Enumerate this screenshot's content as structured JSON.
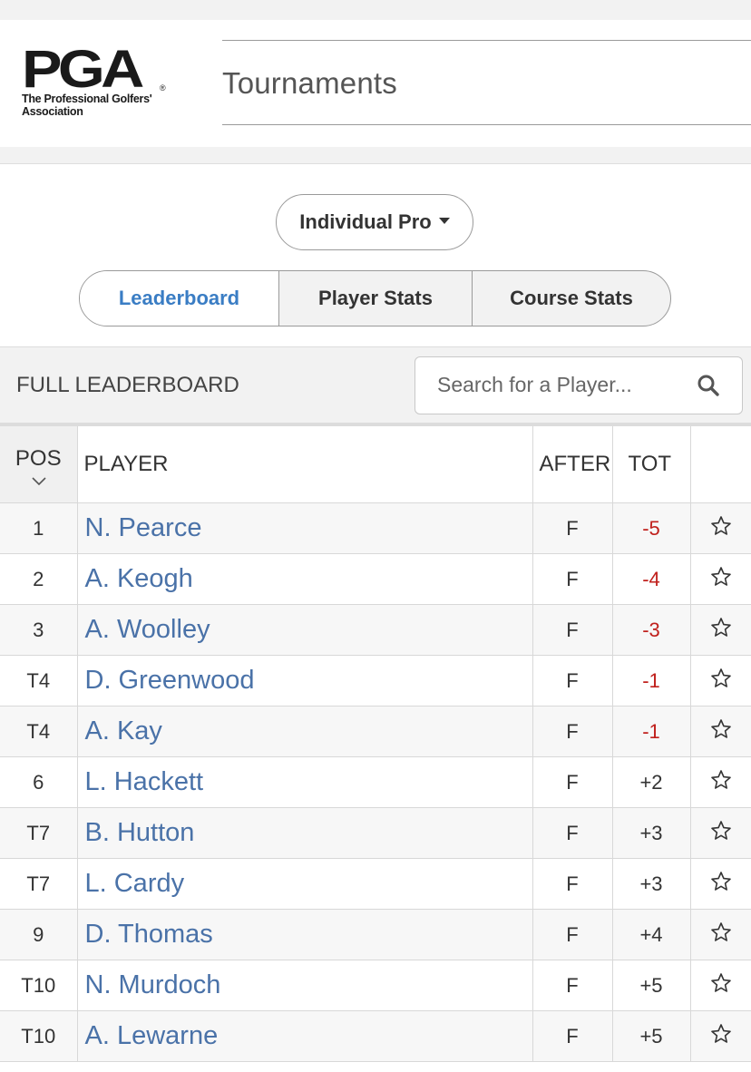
{
  "header": {
    "logo_mark": "PGA",
    "logo_line1": "The Professional Golfers'",
    "logo_line2": "Association",
    "title": "Tournaments"
  },
  "category_dropdown": {
    "selected": "Individual Pro"
  },
  "tabs": [
    {
      "label": "Leaderboard",
      "active": true
    },
    {
      "label": "Player Stats",
      "active": false
    },
    {
      "label": "Course Stats",
      "active": false
    }
  ],
  "leaderboard": {
    "title": "FULL LEADERBOARD",
    "search_placeholder": "Search for a Player...",
    "columns": {
      "pos": "POS",
      "player": "PLAYER",
      "after": "AFTER",
      "tot": "TOT"
    },
    "rows": [
      {
        "pos": "1",
        "player": "N. Pearce",
        "after": "F",
        "tot": "-5"
      },
      {
        "pos": "2",
        "player": "A. Keogh",
        "after": "F",
        "tot": "-4"
      },
      {
        "pos": "3",
        "player": "A. Woolley",
        "after": "F",
        "tot": "-3"
      },
      {
        "pos": "T4",
        "player": "D. Greenwood",
        "after": "F",
        "tot": "-1"
      },
      {
        "pos": "T4",
        "player": "A. Kay",
        "after": "F",
        "tot": "-1"
      },
      {
        "pos": "6",
        "player": "L. Hackett",
        "after": "F",
        "tot": "+2"
      },
      {
        "pos": "T7",
        "player": "B. Hutton",
        "after": "F",
        "tot": "+3"
      },
      {
        "pos": "T7",
        "player": "L. Cardy",
        "after": "F",
        "tot": "+3"
      },
      {
        "pos": "9",
        "player": "D. Thomas",
        "after": "F",
        "tot": "+4"
      },
      {
        "pos": "T10",
        "player": "N. Murdoch",
        "after": "F",
        "tot": "+5"
      },
      {
        "pos": "T10",
        "player": "A. Lewarne",
        "after": "F",
        "tot": "+5"
      }
    ]
  },
  "colors": {
    "accent": "#3a7dc4",
    "player_link": "#4a72a8",
    "under_par": "#c0201c"
  },
  "icons": {
    "search": "search-icon",
    "sort": "chevron-down-icon",
    "favorite": "star-outline-icon"
  }
}
